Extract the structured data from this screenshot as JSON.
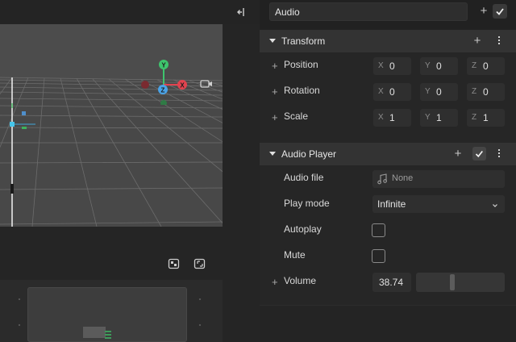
{
  "viewport": {
    "gizmo": {
      "y_label": "Y",
      "x_label": "X",
      "z_label": "Z"
    }
  },
  "inspector": {
    "entity_name": "Audio",
    "transform": {
      "title": "Transform",
      "rows": [
        {
          "label": "Position",
          "x": "0",
          "y": "0",
          "z": "0"
        },
        {
          "label": "Rotation",
          "x": "0",
          "y": "0",
          "z": "0"
        },
        {
          "label": "Scale",
          "x": "1",
          "y": "1",
          "z": "1"
        }
      ],
      "axis_labels": {
        "x": "X",
        "y": "Y",
        "z": "Z"
      }
    },
    "audio_player": {
      "title": "Audio Player",
      "audio_file_label": "Audio file",
      "audio_file_value": "None",
      "play_mode_label": "Play mode",
      "play_mode_value": "Infinite",
      "autoplay_label": "Autoplay",
      "autoplay_checked": false,
      "mute_label": "Mute",
      "mute_checked": false,
      "volume_label": "Volume",
      "volume_value": "38.74",
      "volume_fraction": 0.4
    }
  },
  "colors": {
    "gizmo_y": "#3ec46d",
    "gizmo_x": "#e0434f",
    "gizmo_z": "#4aa3e8",
    "accent": "#3a3a3a"
  },
  "icons": {
    "viewport_tools": [
      "rotate-tool-icon",
      "scale-tool-icon",
      "transform-tool-icon"
    ],
    "collapse": "collapse-panel-icon",
    "camera": "camera-icon",
    "audio_file": "music-note-icon"
  }
}
